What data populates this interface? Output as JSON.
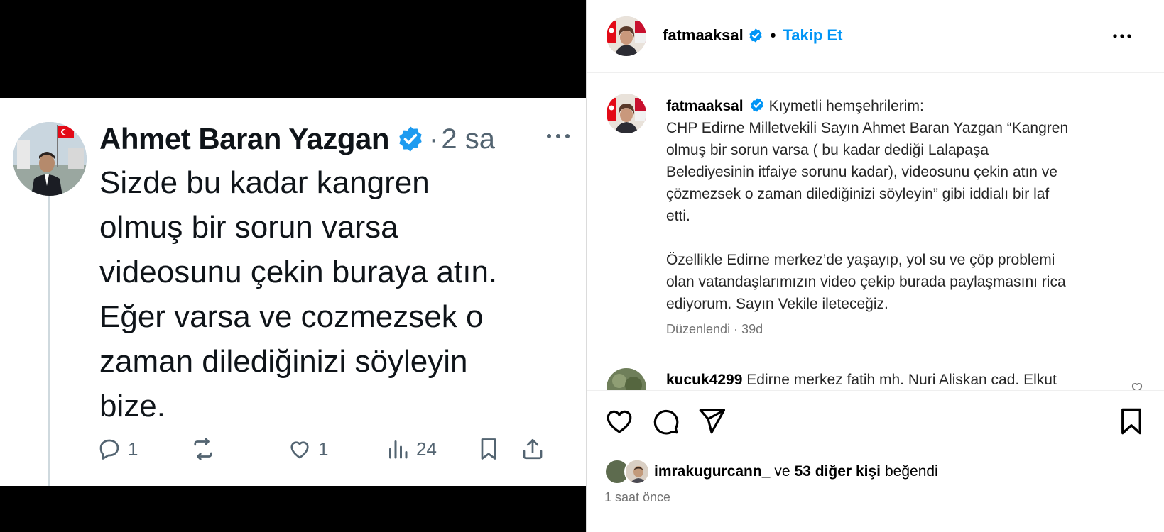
{
  "tweet": {
    "name": "Ahmet Baran Yazgan",
    "separator": "·",
    "time": "2 sa",
    "lines": [
      "Sizde bu kadar kangren",
      "olmuş bir sorun varsa",
      "videosunu çekin buraya atın.",
      "Eğer varsa ve cozmezsek o",
      "zaman dilediğinizi söyleyin",
      "bize."
    ],
    "actions": {
      "reply_count": "1",
      "retweet_count": "",
      "like_count": "1",
      "views_count": "24"
    }
  },
  "post": {
    "username": "fatmaaksal",
    "dot": "•",
    "follow_label": "Takip Et",
    "caption": {
      "username": "fatmaaksal",
      "lines": [
        "Kıymetli hemşehrilerim:",
        "CHP Edirne Milletvekili Sayın Ahmet Baran Yazgan “Kangren",
        "olmuş bir sorun varsa ( bu kadar dediği Lalapaşa",
        "Belediyesinin itfaiye sorunu kadar), videosunu çekin atın ve",
        "çözmezsek o zaman dilediğinizi söyleyin” gibi iddialı bir laf",
        "etti."
      ],
      "lines2": [
        "Özellikle Edirne merkez’de yaşayıp, yol su ve çöp problemi",
        "olan vatandaşlarımızın video çekip burada paylaşmasını rica",
        "ediyorum. Sayın Vekile ileteceğiz."
      ]
    },
    "edited_meta": "Düzenlendi · 39d",
    "comment": {
      "username": "kucuk4299",
      "text": "Edirne merkez fatih mh. Nuri Aliskan cad. Elkut"
    },
    "likes": {
      "first_liker": "imrakugurcann_",
      "connector": "ve",
      "others": "53 diğer kişi",
      "suffix": "beğendi"
    },
    "time_ago": "1 saat önce"
  },
  "colors": {
    "accent": "#0095f6",
    "verified": "#1d9bf0",
    "muted": "#737373",
    "tweet_muted": "#536471"
  }
}
